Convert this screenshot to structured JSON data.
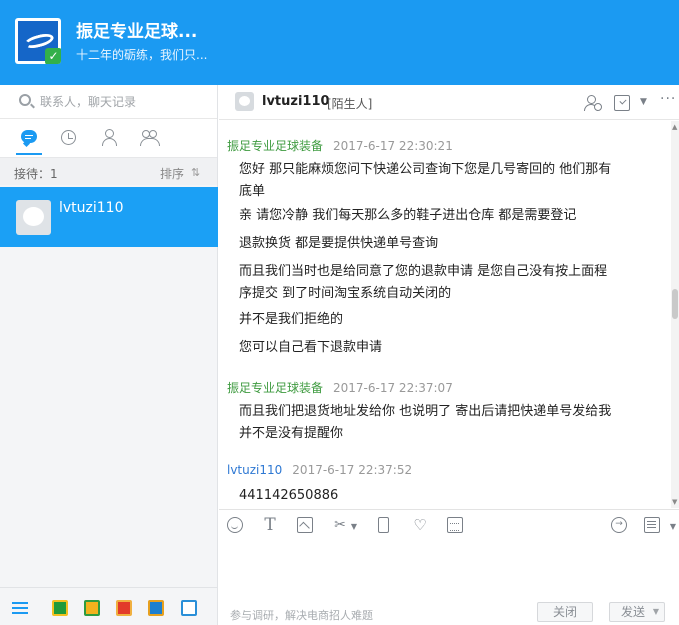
{
  "header": {
    "shop_name": "振足专业足球...",
    "shop_subtitle": "十二年的砺练，我们只..."
  },
  "left_panel": {
    "search_placeholder": "联系人，聊天记录",
    "tabs": [
      "chat-bubble-icon",
      "clock-icon",
      "contact-icon",
      "group-icon"
    ],
    "queue_label": "接待：1",
    "sort_label": "排序",
    "sort_icon": "⇅",
    "contacts": [
      {
        "name": "lvtuzi110",
        "selected": true
      }
    ],
    "dock_icons": [
      "menu-icon",
      "app-green-icon",
      "app-yellow-icon",
      "shop-icon",
      "app-blue-icon",
      "window-icon"
    ]
  },
  "chat": {
    "peer_name": "lvtuzi110",
    "peer_tag": "[陌生人]",
    "toolbar": {
      "more": "···",
      "caret": "▼"
    },
    "messages": [
      {
        "sender": "振足专业足球装备",
        "time": "2017-6-17 22:30:21",
        "lines": [
          "您好 那只能麻烦您问下快递公司查询下您是几号寄回的 他们那有底单",
          "亲 请您冷静 我们每天那么多的鞋子进出仓库 都是需要登记",
          "退款换货 都是要提供快递单号查询",
          "而且我们当时也是给同意了您的退款申请 是您自己没有按上面程序提交 到了时间淘宝系统自动关闭的",
          "并不是我们拒绝的",
          "您可以自己看下退款申请"
        ]
      },
      {
        "sender": "振足专业足球装备",
        "time": "2017-6-17 22:37:07",
        "lines": [
          "而且我们把退货地址发给你 也说明了 寄出后请把快递单号发给我 并不是没有提醒你"
        ]
      },
      {
        "sender": "lvtuzi110",
        "time": "2017-6-17 22:37:52",
        "lines": [
          "441142650886"
        ]
      }
    ]
  },
  "composer": {
    "font_glyph": "T",
    "cut_glyph": "✂",
    "heart_glyph": "♡",
    "caret": "▼",
    "value": "",
    "footer_hint": "参与调研，解决电商招人难题",
    "close_label": "关闭",
    "send_label": "发送"
  },
  "colors": {
    "brand_blue": "#1b9af2",
    "selected_contact": "#1ba0f5",
    "seller_name": "#3f9b40",
    "buyer_name": "#2e78d3"
  }
}
